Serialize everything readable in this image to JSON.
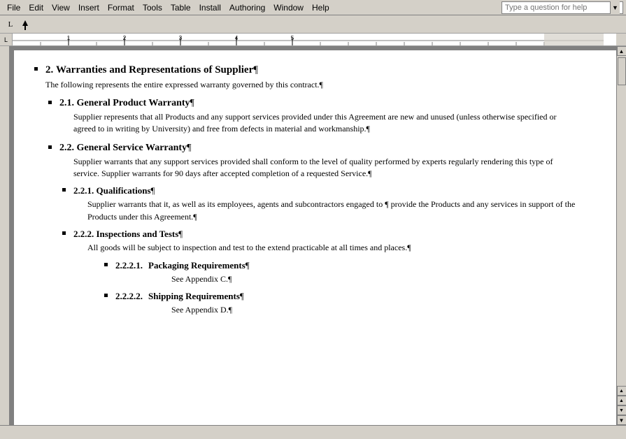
{
  "menubar": {
    "items": [
      "File",
      "Edit",
      "View",
      "Insert",
      "Format",
      "Tools",
      "Table",
      "Install",
      "Authoring",
      "Window",
      "Help"
    ],
    "help_placeholder": "Type a question for help"
  },
  "toolbar": {
    "l_button": "L"
  },
  "document": {
    "sections": [
      {
        "number": "2.",
        "title": "Warranties and Representations of Supplier",
        "pilcrow": "¶",
        "body": "The following represents the entire expressed warranty governed by this contract.¶",
        "subsections": [
          {
            "number": "2.1.",
            "title": "General Product Warranty",
            "pilcrow": "¶",
            "body": "Supplier represents that all Products and any support services provided under this Agreement are new and unused (unless otherwise specified or agreed to in writing by University) and free from defects in material and workmanship.¶"
          },
          {
            "number": "2.2.",
            "title": "General Service Warranty",
            "pilcrow": "¶",
            "body": "Supplier warrants that any support services provided shall conform to the level of quality performed by experts regularly rendering this type of service.  Supplier warrants for 90 days after accepted completion of a requested Service.¶",
            "subsections": [
              {
                "number": "2.2.1.",
                "title": "Qualifications",
                "pilcrow": "¶",
                "body": "Supplier warrants that it, as well as its employees, agents and subcontractors engaged to ¶\nprovide the Products and any services in support of the Products under this Agreement.¶"
              },
              {
                "number": "2.2.2.",
                "title": "Inspections and Tests",
                "pilcrow": "¶",
                "body": "All goods will be subject to inspection and test to the extend practicable at all times and places.¶",
                "subsections": [
                  {
                    "number": "2.2.2.1.",
                    "title": "Packaging Requirements",
                    "pilcrow": "¶",
                    "body": "See Appendix C.¶"
                  },
                  {
                    "number": "2.2.2.2.",
                    "title": "Shipping Requirements",
                    "pilcrow": "¶",
                    "body": "See Appendix D.¶"
                  }
                ]
              }
            ]
          }
        ]
      }
    ]
  },
  "status": ""
}
